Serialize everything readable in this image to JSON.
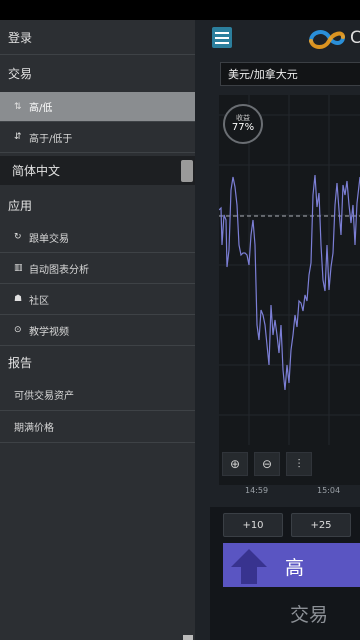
{
  "drawer": {
    "login": "登录",
    "trading_header": "交易",
    "trading_items": [
      {
        "label": "高/低",
        "icon": "high-low-icon"
      },
      {
        "label": "高于/低于",
        "icon": "above-below-icon"
      }
    ],
    "language": "简体中文",
    "apps_header": "应用",
    "apps_items": [
      {
        "label": "跟单交易",
        "icon": "copy-trade-icon"
      },
      {
        "label": "自动图表分析",
        "icon": "chart-analysis-icon"
      },
      {
        "label": "社区",
        "icon": "community-icon"
      },
      {
        "label": "教学视频",
        "icon": "video-icon"
      }
    ],
    "reports_header": "报告",
    "reports_items": [
      {
        "label": "可供交易资产"
      },
      {
        "label": "期满价格"
      }
    ]
  },
  "main": {
    "logo_letter": "C",
    "asset_pair": "美元/加拿大元",
    "payout": {
      "label": "收益",
      "value": "77%"
    },
    "time_axis": [
      "14:59",
      "15:04"
    ],
    "amount_buttons": [
      "+10",
      "+25"
    ],
    "high_button": "高",
    "trade_label": "交易"
  },
  "colors": {
    "accent_blue": "#2c7f9d",
    "high_button": "#5a55c2",
    "chart_line": "#7c7fd6"
  }
}
